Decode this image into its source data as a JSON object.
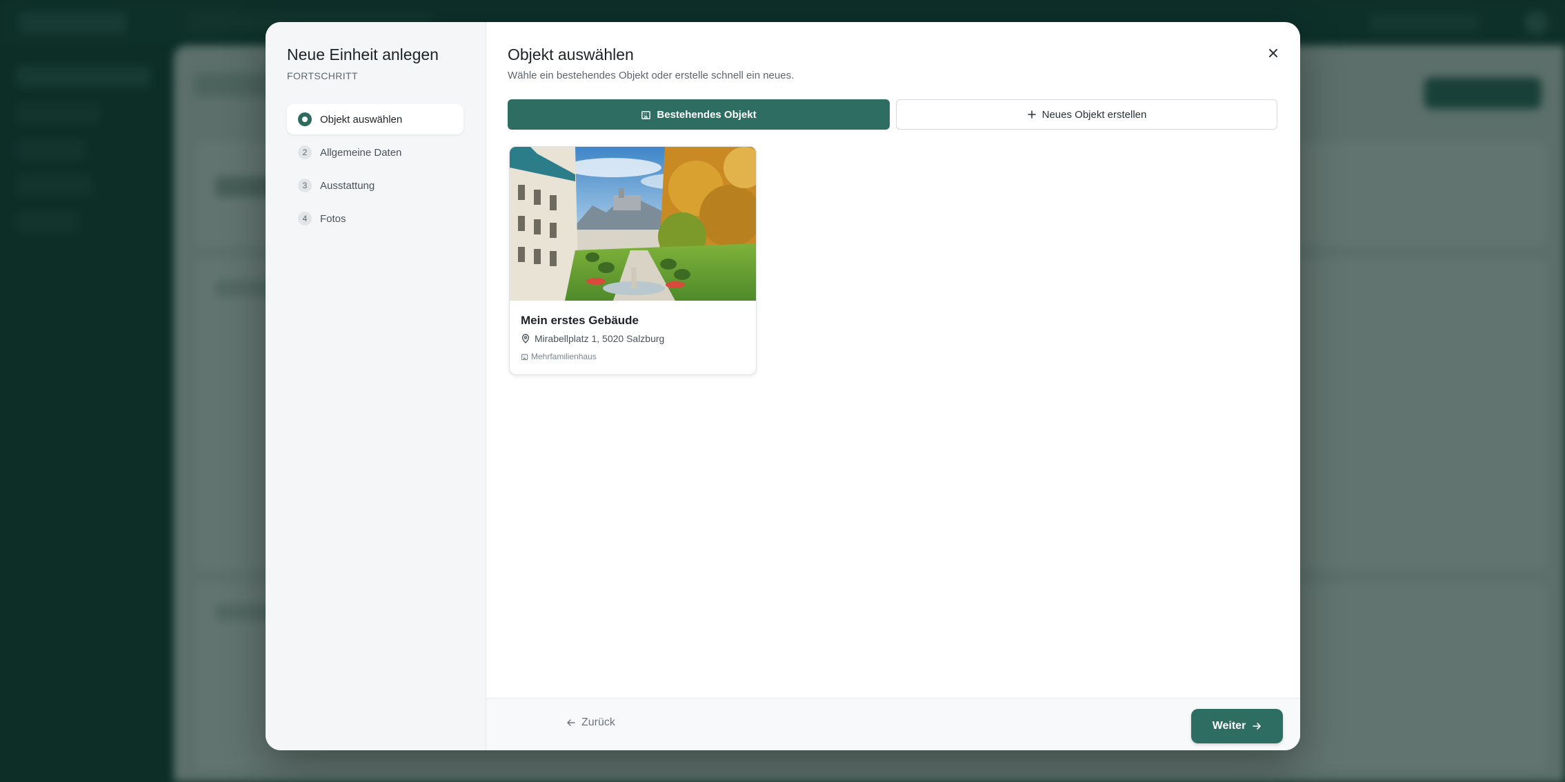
{
  "modal": {
    "title": "Neue Einheit anlegen",
    "progress_label": "FORTSCHRITT",
    "steps": [
      {
        "number": "",
        "label": "Objekt auswählen",
        "state": "active"
      },
      {
        "number": "2",
        "label": "Allgemeine Daten",
        "state": "pending"
      },
      {
        "number": "3",
        "label": "Ausstattung",
        "state": "pending"
      },
      {
        "number": "4",
        "label": "Fotos",
        "state": "pending"
      }
    ],
    "content": {
      "title": "Objekt auswählen",
      "subtitle": "Wähle ein bestehendes Objekt oder erstelle schnell ein neues.",
      "toggle": {
        "existing_label": "Bestehendes Objekt",
        "new_label": "Neues Objekt erstellen",
        "selected": "existing"
      },
      "objects": [
        {
          "name": "Mein erstes Gebäude",
          "address": "Mirabellplatz 1, 5020 Salzburg",
          "type": "Mehrfamilienhaus"
        }
      ]
    },
    "footer": {
      "back_label": "Zurück",
      "next_label": "Weiter"
    }
  },
  "colors": {
    "accent": "#2e6e62",
    "background": "#0f3b33",
    "overlay": "rgba(12,38,33,0.62)"
  },
  "icons": [
    "close-icon",
    "building-icon",
    "plus-icon",
    "map-pin-icon",
    "arrow-left-icon",
    "arrow-right-icon"
  ]
}
